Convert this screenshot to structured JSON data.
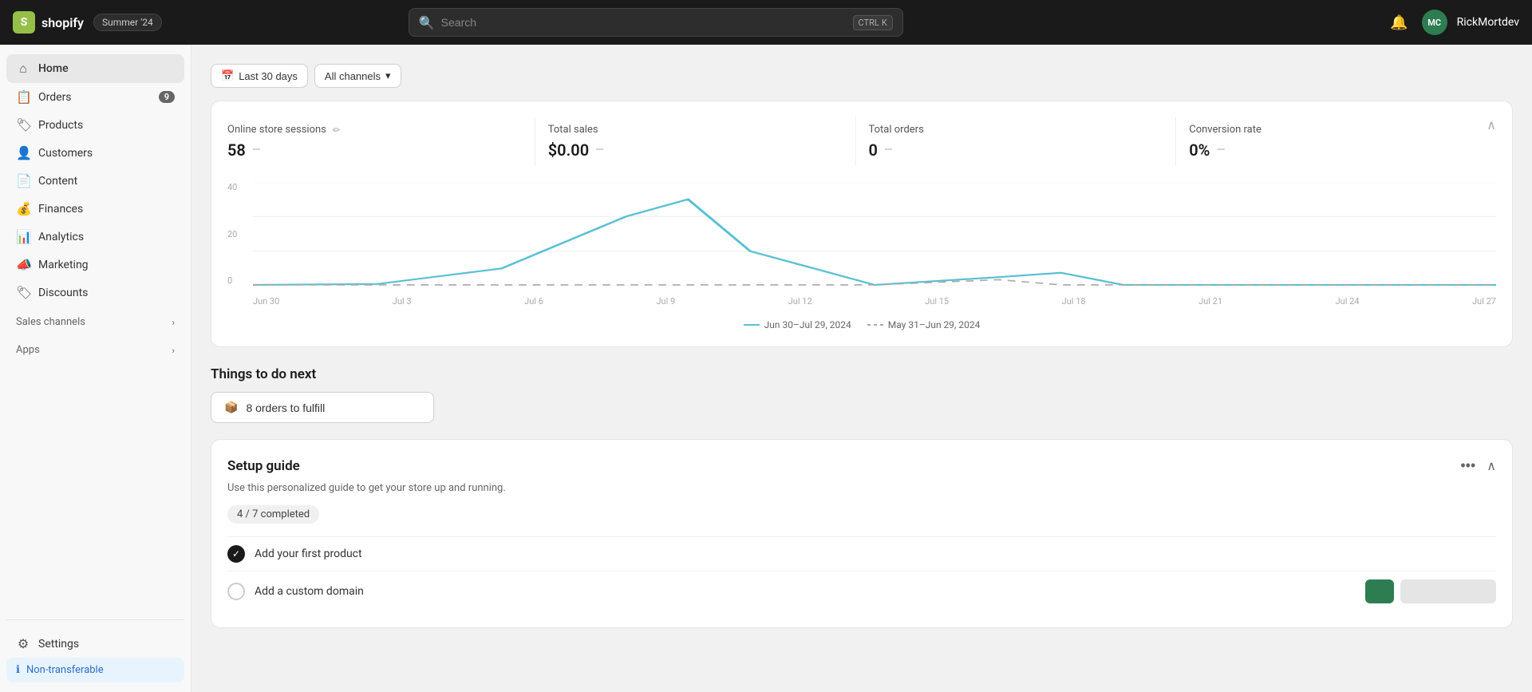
{
  "topnav": {
    "logo_letter": "S",
    "logo_text": "shopify",
    "badge_text": "Summer '24",
    "search_placeholder": "Search",
    "shortcut_ctrl": "CTRL",
    "shortcut_k": "K",
    "bell_icon": "🔔",
    "avatar_text": "MC",
    "username": "RickMortdev"
  },
  "sidebar": {
    "items": [
      {
        "id": "home",
        "label": "Home",
        "icon": "⌂",
        "badge": null,
        "active": true
      },
      {
        "id": "orders",
        "label": "Orders",
        "icon": "📋",
        "badge": "9",
        "active": false
      },
      {
        "id": "products",
        "label": "Products",
        "icon": "🏷",
        "badge": null,
        "active": false
      },
      {
        "id": "customers",
        "label": "Customers",
        "icon": "👤",
        "badge": null,
        "active": false
      },
      {
        "id": "content",
        "label": "Content",
        "icon": "📄",
        "badge": null,
        "active": false
      },
      {
        "id": "finances",
        "label": "Finances",
        "icon": "💰",
        "badge": null,
        "active": false
      },
      {
        "id": "analytics",
        "label": "Analytics",
        "icon": "📊",
        "badge": null,
        "active": false
      },
      {
        "id": "marketing",
        "label": "Marketing",
        "icon": "📣",
        "badge": null,
        "active": false
      },
      {
        "id": "discounts",
        "label": "Discounts",
        "icon": "🏷",
        "badge": null,
        "active": false
      }
    ],
    "sales_channels_label": "Sales channels",
    "apps_label": "Apps",
    "settings_label": "Settings",
    "non_transferable_label": "Non-transferable"
  },
  "filters": {
    "date_label": "Last 30 days",
    "channel_label": "All channels",
    "calendar_icon": "📅",
    "chevron_icon": "▾"
  },
  "stats": {
    "online_sessions_label": "Online store sessions",
    "online_sessions_value": "58",
    "online_sessions_dash": "—",
    "total_sales_label": "Total sales",
    "total_sales_value": "$0.00",
    "total_sales_dash": "—",
    "total_orders_label": "Total orders",
    "total_orders_value": "0",
    "total_orders_dash": "—",
    "conversion_rate_label": "Conversion rate",
    "conversion_rate_value": "0%",
    "conversion_rate_dash": "—"
  },
  "chart": {
    "y_labels": [
      "40",
      "20",
      "0"
    ],
    "x_labels": [
      "Jun 30",
      "Jul 3",
      "Jul 6",
      "Jul 9",
      "Jul 12",
      "Jul 15",
      "Jul 18",
      "Jul 21",
      "Jul 24",
      "Jul 27"
    ],
    "legend_current": "Jun 30–Jul 29, 2024",
    "legend_previous": "May 31–Jun 29, 2024"
  },
  "things_to_do": {
    "title": "Things to do next",
    "fulfill_icon": "📦",
    "fulfill_label": "8 orders to fulfill"
  },
  "setup_guide": {
    "title": "Setup guide",
    "subtitle": "Use this personalized guide to get your store up and running.",
    "progress_label": "4 / 7 completed",
    "tasks": [
      {
        "id": "task-1",
        "label": "Add your first product",
        "done": true
      },
      {
        "id": "task-2",
        "label": "Add a custom domain",
        "done": false
      }
    ]
  }
}
